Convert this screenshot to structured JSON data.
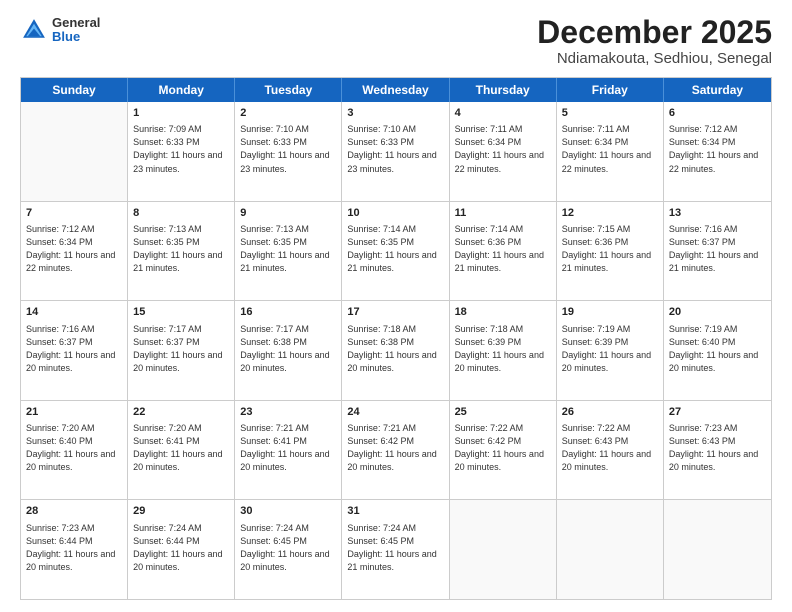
{
  "header": {
    "logo_general": "General",
    "logo_blue": "Blue",
    "month_title": "December 2025",
    "location": "Ndiamakouta, Sedhiou, Senegal"
  },
  "weekdays": [
    "Sunday",
    "Monday",
    "Tuesday",
    "Wednesday",
    "Thursday",
    "Friday",
    "Saturday"
  ],
  "weeks": [
    [
      {
        "day": "",
        "empty": true
      },
      {
        "day": "1",
        "sunrise": "Sunrise: 7:09 AM",
        "sunset": "Sunset: 6:33 PM",
        "daylight": "Daylight: 11 hours and 23 minutes."
      },
      {
        "day": "2",
        "sunrise": "Sunrise: 7:10 AM",
        "sunset": "Sunset: 6:33 PM",
        "daylight": "Daylight: 11 hours and 23 minutes."
      },
      {
        "day": "3",
        "sunrise": "Sunrise: 7:10 AM",
        "sunset": "Sunset: 6:33 PM",
        "daylight": "Daylight: 11 hours and 23 minutes."
      },
      {
        "day": "4",
        "sunrise": "Sunrise: 7:11 AM",
        "sunset": "Sunset: 6:34 PM",
        "daylight": "Daylight: 11 hours and 22 minutes."
      },
      {
        "day": "5",
        "sunrise": "Sunrise: 7:11 AM",
        "sunset": "Sunset: 6:34 PM",
        "daylight": "Daylight: 11 hours and 22 minutes."
      },
      {
        "day": "6",
        "sunrise": "Sunrise: 7:12 AM",
        "sunset": "Sunset: 6:34 PM",
        "daylight": "Daylight: 11 hours and 22 minutes."
      }
    ],
    [
      {
        "day": "7",
        "sunrise": "Sunrise: 7:12 AM",
        "sunset": "Sunset: 6:34 PM",
        "daylight": "Daylight: 11 hours and 22 minutes."
      },
      {
        "day": "8",
        "sunrise": "Sunrise: 7:13 AM",
        "sunset": "Sunset: 6:35 PM",
        "daylight": "Daylight: 11 hours and 21 minutes."
      },
      {
        "day": "9",
        "sunrise": "Sunrise: 7:13 AM",
        "sunset": "Sunset: 6:35 PM",
        "daylight": "Daylight: 11 hours and 21 minutes."
      },
      {
        "day": "10",
        "sunrise": "Sunrise: 7:14 AM",
        "sunset": "Sunset: 6:35 PM",
        "daylight": "Daylight: 11 hours and 21 minutes."
      },
      {
        "day": "11",
        "sunrise": "Sunrise: 7:14 AM",
        "sunset": "Sunset: 6:36 PM",
        "daylight": "Daylight: 11 hours and 21 minutes."
      },
      {
        "day": "12",
        "sunrise": "Sunrise: 7:15 AM",
        "sunset": "Sunset: 6:36 PM",
        "daylight": "Daylight: 11 hours and 21 minutes."
      },
      {
        "day": "13",
        "sunrise": "Sunrise: 7:16 AM",
        "sunset": "Sunset: 6:37 PM",
        "daylight": "Daylight: 11 hours and 21 minutes."
      }
    ],
    [
      {
        "day": "14",
        "sunrise": "Sunrise: 7:16 AM",
        "sunset": "Sunset: 6:37 PM",
        "daylight": "Daylight: 11 hours and 20 minutes."
      },
      {
        "day": "15",
        "sunrise": "Sunrise: 7:17 AM",
        "sunset": "Sunset: 6:37 PM",
        "daylight": "Daylight: 11 hours and 20 minutes."
      },
      {
        "day": "16",
        "sunrise": "Sunrise: 7:17 AM",
        "sunset": "Sunset: 6:38 PM",
        "daylight": "Daylight: 11 hours and 20 minutes."
      },
      {
        "day": "17",
        "sunrise": "Sunrise: 7:18 AM",
        "sunset": "Sunset: 6:38 PM",
        "daylight": "Daylight: 11 hours and 20 minutes."
      },
      {
        "day": "18",
        "sunrise": "Sunrise: 7:18 AM",
        "sunset": "Sunset: 6:39 PM",
        "daylight": "Daylight: 11 hours and 20 minutes."
      },
      {
        "day": "19",
        "sunrise": "Sunrise: 7:19 AM",
        "sunset": "Sunset: 6:39 PM",
        "daylight": "Daylight: 11 hours and 20 minutes."
      },
      {
        "day": "20",
        "sunrise": "Sunrise: 7:19 AM",
        "sunset": "Sunset: 6:40 PM",
        "daylight": "Daylight: 11 hours and 20 minutes."
      }
    ],
    [
      {
        "day": "21",
        "sunrise": "Sunrise: 7:20 AM",
        "sunset": "Sunset: 6:40 PM",
        "daylight": "Daylight: 11 hours and 20 minutes."
      },
      {
        "day": "22",
        "sunrise": "Sunrise: 7:20 AM",
        "sunset": "Sunset: 6:41 PM",
        "daylight": "Daylight: 11 hours and 20 minutes."
      },
      {
        "day": "23",
        "sunrise": "Sunrise: 7:21 AM",
        "sunset": "Sunset: 6:41 PM",
        "daylight": "Daylight: 11 hours and 20 minutes."
      },
      {
        "day": "24",
        "sunrise": "Sunrise: 7:21 AM",
        "sunset": "Sunset: 6:42 PM",
        "daylight": "Daylight: 11 hours and 20 minutes."
      },
      {
        "day": "25",
        "sunrise": "Sunrise: 7:22 AM",
        "sunset": "Sunset: 6:42 PM",
        "daylight": "Daylight: 11 hours and 20 minutes."
      },
      {
        "day": "26",
        "sunrise": "Sunrise: 7:22 AM",
        "sunset": "Sunset: 6:43 PM",
        "daylight": "Daylight: 11 hours and 20 minutes."
      },
      {
        "day": "27",
        "sunrise": "Sunrise: 7:23 AM",
        "sunset": "Sunset: 6:43 PM",
        "daylight": "Daylight: 11 hours and 20 minutes."
      }
    ],
    [
      {
        "day": "28",
        "sunrise": "Sunrise: 7:23 AM",
        "sunset": "Sunset: 6:44 PM",
        "daylight": "Daylight: 11 hours and 20 minutes."
      },
      {
        "day": "29",
        "sunrise": "Sunrise: 7:24 AM",
        "sunset": "Sunset: 6:44 PM",
        "daylight": "Daylight: 11 hours and 20 minutes."
      },
      {
        "day": "30",
        "sunrise": "Sunrise: 7:24 AM",
        "sunset": "Sunset: 6:45 PM",
        "daylight": "Daylight: 11 hours and 20 minutes."
      },
      {
        "day": "31",
        "sunrise": "Sunrise: 7:24 AM",
        "sunset": "Sunset: 6:45 PM",
        "daylight": "Daylight: 11 hours and 21 minutes."
      },
      {
        "day": "",
        "empty": true
      },
      {
        "day": "",
        "empty": true
      },
      {
        "day": "",
        "empty": true
      }
    ]
  ]
}
